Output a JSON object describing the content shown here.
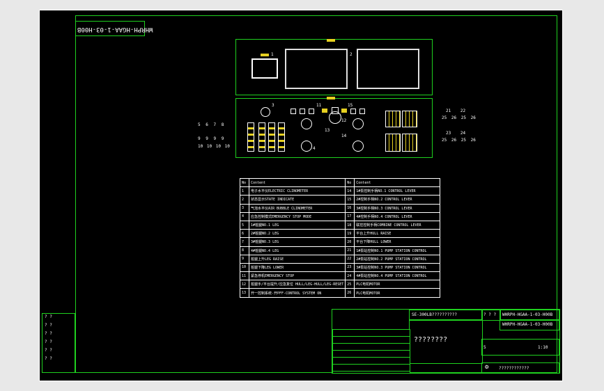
{
  "drawing": {
    "stamp_label": "WHRPH-HGAA-1-03-H00B",
    "panel_labels": [
      "1",
      "2",
      "3",
      "4",
      "11",
      "12",
      "13",
      "14",
      "15"
    ],
    "side_row1": [
      "5",
      "6",
      "7",
      "8"
    ],
    "side_row2": [
      "9",
      "9",
      "9",
      "9"
    ],
    "side_row3": [
      "10",
      "10",
      "10",
      "10"
    ],
    "right_labels_top": [
      "21",
      "22"
    ],
    "right_labels_top2": [
      "25",
      "26",
      "25",
      "26"
    ],
    "right_labels_bot": [
      "23",
      "24"
    ],
    "right_labels_bot2": [
      "25",
      "26",
      "25",
      "26"
    ]
  },
  "bom": {
    "header": [
      "No",
      "Content",
      "No",
      "Content"
    ],
    "rows": [
      [
        "1",
        "电子水平仪ELECTRIC CLINOMETER",
        "14",
        "1#泵控制手柄NO.1 CONTROL LEVER"
      ],
      [
        "2",
        "状态显示STATE INDICATE",
        "15",
        "2#控制手柄NO.2 CONTROL LEVER"
      ],
      [
        "3",
        "气泡水平仪AIR BUBBLE CLINOMETER",
        "16",
        "3#控制手柄NO.3 CONTROL LEVER"
      ],
      [
        "4",
        "应急控制模式EMERGENCY STOP MODE",
        "17",
        "4#控制手柄NO.4 CONTROL LEVER"
      ],
      [
        "5",
        "1#桩腿NO.1 LEG",
        "18",
        "联控控制手柄COMBINE CONTROL LEVER"
      ],
      [
        "6",
        "2#桩腿NO.2 LEG",
        "19",
        "平台上升HULL RAISE"
      ],
      [
        "7",
        "3#桩腿NO.3 LEG",
        "20",
        "平台下降HULL LOWER"
      ],
      [
        "8",
        "4#桩腿NO.4 LEG",
        "21",
        "1#泵站控制NO.1 PUMP STATION CONTROL"
      ],
      [
        "9",
        "桩腿上升LEG RAISE",
        "22",
        "2#泵站控制NO.2 PUMP STATION CONTROL"
      ],
      [
        "10",
        "桩腿下降LEG LOWER",
        "23",
        "3#泵站控制NO.3 PUMP STATION CONTROL"
      ],
      [
        "11",
        "紧急停机EMERGENCY STOP",
        "24",
        "4#泵站控制NO.4 PUMP STATION CONTROL"
      ],
      [
        "12",
        "桩腿手/平台提升/应急复位 HULL/LEG-HULL/LEG-RESET",
        "25",
        "PLC电机MOTOR"
      ],
      [
        "13",
        "开一控制系统-开PFF-CONTROL SYSTEM ON",
        "26",
        "PLC电机MOTOR"
      ]
    ]
  },
  "title_block": {
    "project": "SE-300LB??????????",
    "drawing_no_1": "WHRPH-HGAA-1-03-H00B",
    "drawing_no_2": "WHRPH-HGAA-1-03-H00B",
    "title": "????????",
    "scale": "1:10",
    "sheet": "5",
    "company": "????????????",
    "row_q": "? ?",
    "row_q3": "? ? ?"
  },
  "colors": {
    "background": "#000000",
    "frame": "#ffffff",
    "border": "#1fd11f",
    "highlight": "#e6d020"
  }
}
